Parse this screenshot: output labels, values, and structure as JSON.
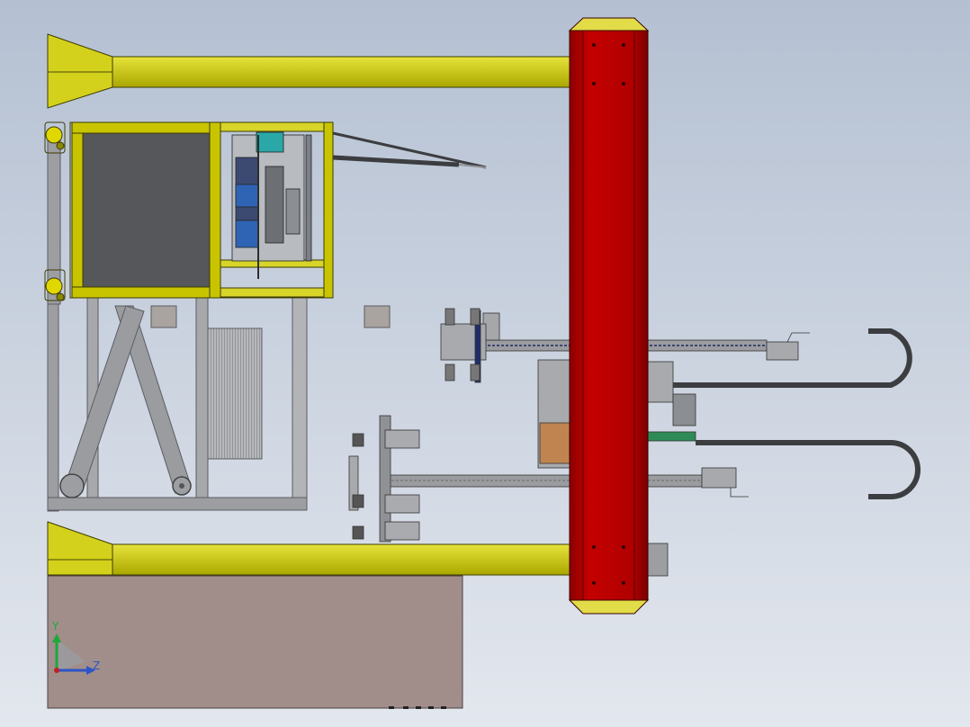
{
  "view": {
    "type": "cad-assembly-view",
    "background_top": "#b4c0d2",
    "background_bottom": "#e3e7ee"
  },
  "colors": {
    "frame_yellow": "#c8c500",
    "frame_yellow_light": "#e1de2a",
    "frame_yellow_dark": "#8f8c00",
    "column_red": "#b20000",
    "column_red_dark": "#7e0000",
    "column_cap": "#e2dc49",
    "steel_grey": "#9c9ea2",
    "steel_dark": "#6f7175",
    "panel_dark": "#55575a",
    "base_plate": "#a18e8a",
    "cable_dark": "#3c3d40",
    "teal_motor": "#2aa7a7",
    "blue_part": "#2f64b5",
    "green_part": "#2e8b57"
  },
  "triad": {
    "y_label": "Y",
    "z_label": "Z",
    "y_color": "#1fa83a",
    "z_color": "#2d53c8",
    "origin_color": "#c02020"
  }
}
